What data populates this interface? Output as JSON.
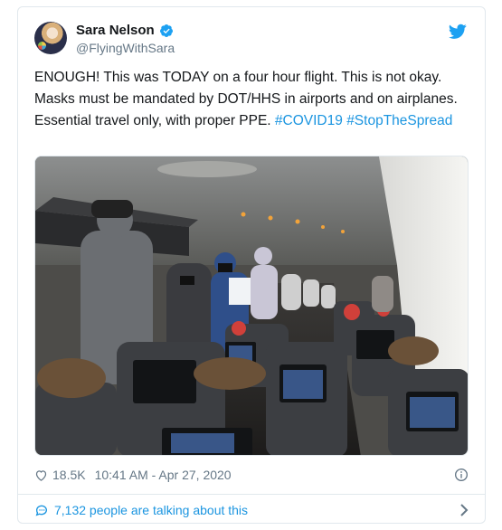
{
  "tweet": {
    "author_name": "Sara Nelson",
    "handle": "@FlyingWithSara",
    "text_part1": "ENOUGH! This was TODAY on a four hour flight. This is not okay. Masks must be mandated by DOT/HHS in airports and on airplanes. Essential travel only, with proper PPE. ",
    "hashtag1": "#COVID19",
    "hashtag2": "#StopTheSpread",
    "likes": "18.5K",
    "timestamp": "10:41 AM - Apr 27, 2020",
    "talking": "7,132 people are talking about this"
  },
  "icons": {
    "verified": "verified-badge-icon",
    "logo": "twitter-bird-icon",
    "like": "heart-icon",
    "info": "info-icon",
    "reply": "speech-bubble-icon",
    "more": "chevron-right-icon"
  },
  "colors": {
    "link": "#1b95e0",
    "muted": "#657786",
    "text": "#14171a",
    "border": "#e1e8ed"
  }
}
